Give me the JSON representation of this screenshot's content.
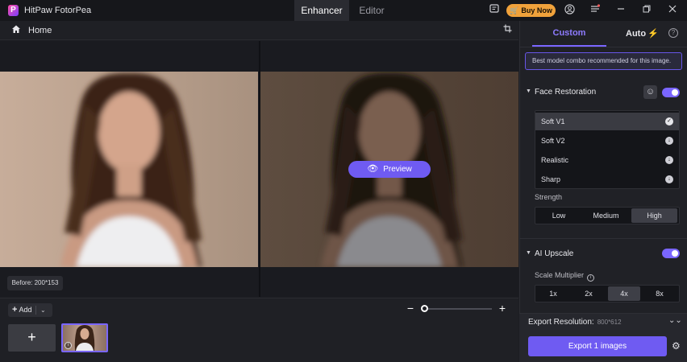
{
  "app": {
    "logo_letter": "P",
    "name": "HitPaw FotorPea"
  },
  "top_tabs": [
    {
      "label": "Enhancer",
      "active": true
    },
    {
      "label": "Editor",
      "active": false
    }
  ],
  "titlebar": {
    "buy_now": "Buy Now",
    "icons": [
      "feedback-icon",
      "cart-icon",
      "account-icon",
      "menu-icon",
      "minimize-icon",
      "maximize-icon",
      "close-icon"
    ]
  },
  "home": {
    "label": "Home"
  },
  "canvas": {
    "preview_label": "Preview",
    "before_label": "Before: 200*153"
  },
  "bottom": {
    "add_label": "Add",
    "zoom_level": 0.0
  },
  "panel": {
    "tabs": [
      {
        "label": "Custom",
        "active": true
      },
      {
        "label": "Auto",
        "active": false
      }
    ],
    "hint": "Best model combo recommended for this image.",
    "face": {
      "title": "Face Restoration",
      "enabled": true,
      "models": [
        {
          "label": "Soft V1",
          "selected": true
        },
        {
          "label": "Soft V2",
          "selected": false
        },
        {
          "label": "Realistic",
          "selected": false
        },
        {
          "label": "Sharp",
          "selected": false
        }
      ],
      "strength_label": "Strength",
      "strength_options": [
        "Low",
        "Medium",
        "High"
      ],
      "strength_selected": "High"
    },
    "upscale": {
      "title": "AI Upscale",
      "enabled": true,
      "scale_label": "Scale Multiplier",
      "scale_options": [
        "1x",
        "2x",
        "4x",
        "8x"
      ],
      "scale_selected": "4x"
    },
    "export": {
      "res_label": "Export Resolution:",
      "res_value": "800*612",
      "button": "Export 1 images"
    }
  },
  "colors": {
    "accent": "#6f5bf2",
    "buy_now": "#f0a23b",
    "background": "#1c1d22"
  }
}
